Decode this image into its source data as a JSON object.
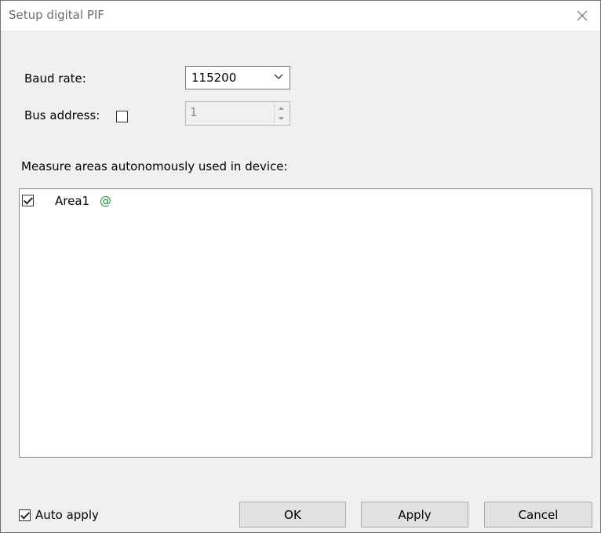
{
  "window": {
    "title": "Setup digital PIF"
  },
  "form": {
    "baud_rate_label": "Baud rate:",
    "baud_rate_value": "115200",
    "bus_address_label": "Bus address:",
    "bus_address_checked": false,
    "bus_address_value": "1",
    "measure_areas_label": "Measure areas autonomously used in device:"
  },
  "areas": [
    {
      "label": "Area1",
      "checked": true,
      "marker": "@"
    }
  ],
  "footer": {
    "auto_apply_label": "Auto apply",
    "auto_apply_checked": true,
    "ok_label": "OK",
    "apply_label": "Apply",
    "cancel_label": "Cancel"
  },
  "colors": {
    "marker": "#1e8e3e",
    "title_text": "#6d6d6d"
  },
  "icons": {
    "close": "close-icon",
    "dropdown": "chevron-down-icon",
    "spin_up": "spin-up-icon",
    "spin_down": "spin-down-icon"
  }
}
